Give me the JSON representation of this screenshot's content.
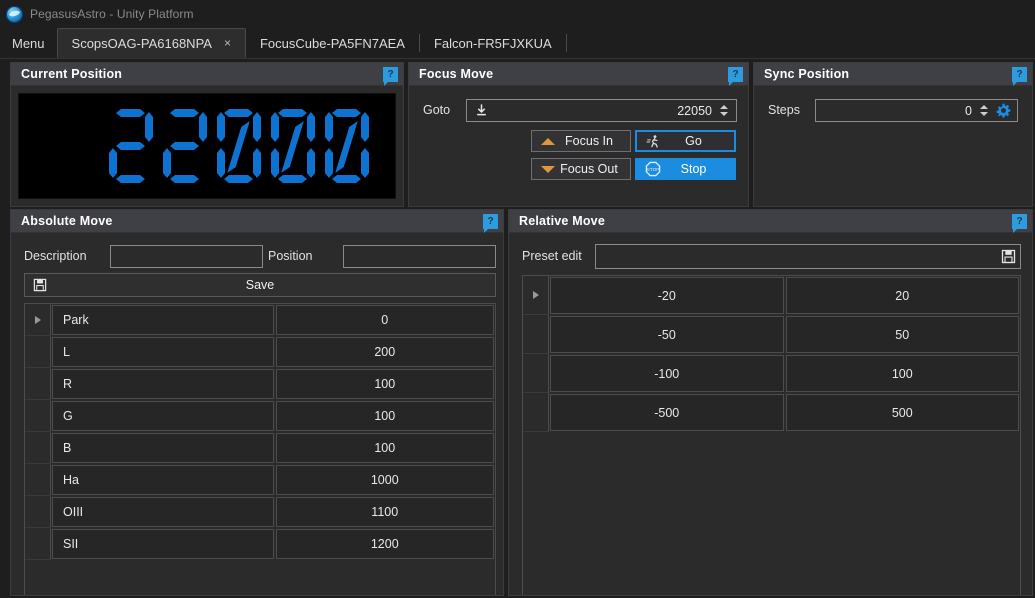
{
  "window": {
    "title": "PegasusAstro - Unity Platform",
    "logo_icon": "pegasus-globe-icon"
  },
  "tabbar": {
    "menu_label": "Menu",
    "tabs": [
      {
        "label": "ScopsOAG-PA6168NPA",
        "active": true,
        "close_glyph": "×"
      },
      {
        "label": "FocusCube-PA5FN7AEA",
        "active": false
      },
      {
        "label": "Falcon-FR5FJXKUA",
        "active": false
      }
    ]
  },
  "panels": {
    "current_position": {
      "title": "Current Position",
      "help_glyph": "?",
      "value": "22000",
      "digit_color": "#0d72d0",
      "background": "#000000"
    },
    "focus_move": {
      "title": "Focus Move",
      "help_glyph": "?",
      "goto_label": "Goto",
      "goto_value": "22050",
      "goto_icon": "download-icon",
      "focus_in_label": "Focus In",
      "focus_in_icon": "chevron-up-icon",
      "focus_out_label": "Focus Out",
      "focus_out_icon": "chevron-down-icon",
      "go_label": "Go",
      "go_icon": "running-person-icon",
      "stop_label": "Stop",
      "stop_icon": "stop-sign-icon",
      "accent_color": "#1b8ce0",
      "chevron_color": "#e0963c"
    },
    "sync_position": {
      "title": "Sync Position",
      "help_glyph": "?",
      "steps_label": "Steps",
      "steps_value": "0",
      "gear_icon": "gear-icon",
      "gear_color": "#1b8ce0"
    },
    "absolute_move": {
      "title": "Absolute Move",
      "help_glyph": "?",
      "description_label": "Description",
      "description_value": "",
      "description_placeholder": "",
      "position_label": "Position",
      "position_value": "",
      "position_placeholder": "",
      "save_label": "Save",
      "save_icon": "floppy-disk-icon",
      "rows": [
        {
          "description": "Park",
          "position": "0",
          "selected": true
        },
        {
          "description": "L",
          "position": "200",
          "selected": false
        },
        {
          "description": "R",
          "position": "100",
          "selected": false
        },
        {
          "description": "G",
          "position": "100",
          "selected": false
        },
        {
          "description": "B",
          "position": "100",
          "selected": false
        },
        {
          "description": "Ha",
          "position": "1000",
          "selected": false
        },
        {
          "description": "OIII",
          "position": "1100",
          "selected": false
        },
        {
          "description": "SII",
          "position": "1200",
          "selected": false
        }
      ]
    },
    "relative_move": {
      "title": "Relative Move",
      "help_glyph": "?",
      "preset_label": "Preset edit",
      "preset_value": "",
      "preset_placeholder": "",
      "preset_save_icon": "floppy-disk-icon",
      "rows": [
        {
          "negative": "-20",
          "positive": "20",
          "selected": true
        },
        {
          "negative": "-50",
          "positive": "50",
          "selected": false
        },
        {
          "negative": "-100",
          "positive": "100",
          "selected": false
        },
        {
          "negative": "-500",
          "positive": "500",
          "selected": false
        }
      ]
    }
  }
}
